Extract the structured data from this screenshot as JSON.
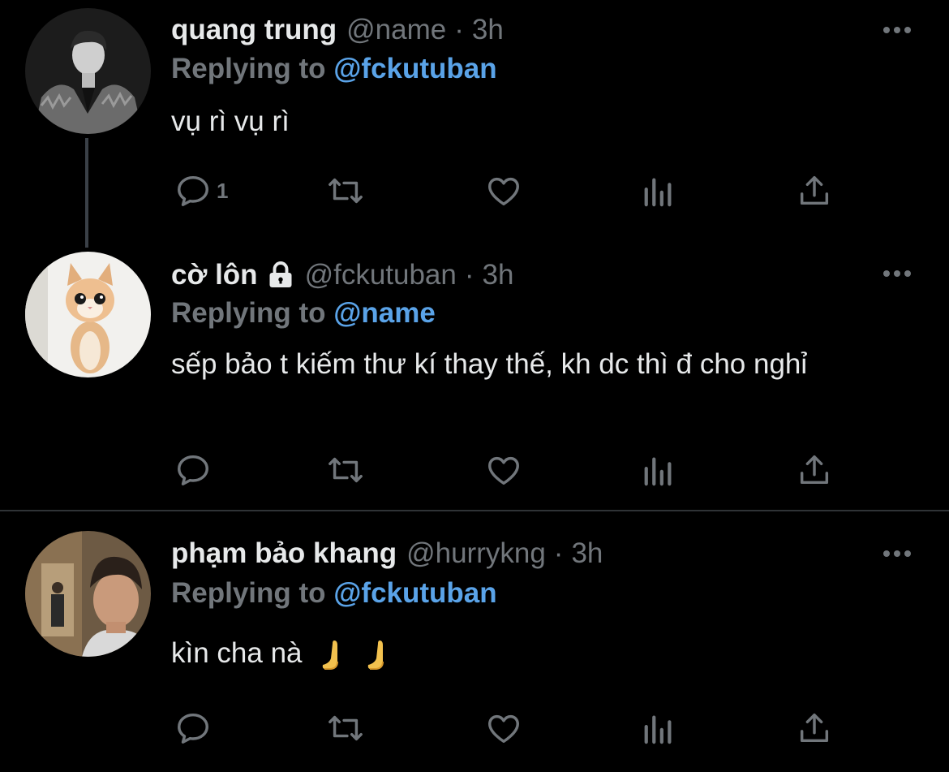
{
  "tweets": [
    {
      "name": "quang trung",
      "handle": "@name",
      "dot": "·",
      "time": "3h",
      "replying_label": "Replying to",
      "replying_to": "@fckutuban",
      "text": "vụ rì vụ rì",
      "reply_count": "1",
      "avatar_icon": "person-photo-avatar",
      "protected": false
    },
    {
      "name": "cờ lôn",
      "handle": "@fckutuban",
      "dot": "·",
      "time": "3h",
      "replying_label": "Replying to",
      "replying_to": "@name",
      "text": "sếp bảo t kiếm thư kí thay thế, kh dc thì đ cho nghỉ",
      "reply_count": "",
      "avatar_icon": "cat-photo-avatar",
      "protected": true
    },
    {
      "name": "phạm bảo khang",
      "handle": "@hurrykng",
      "dot": "·",
      "time": "3h",
      "replying_label": "Replying to",
      "replying_to": "@fckutuban",
      "text": "kìn cha nà",
      "reply_count": "",
      "avatar_icon": "selfie-photo-avatar",
      "protected": false
    }
  ],
  "icons": [
    "reply-icon",
    "retweet-icon",
    "like-icon",
    "views-icon",
    "share-icon",
    "more-icon",
    "lock-icon",
    "pray-emoji"
  ],
  "colors": {
    "background": "#000000",
    "text": "#e7e9ea",
    "muted": "#71767b",
    "mention": "#5aa3e8",
    "divider": "#2f3336"
  }
}
